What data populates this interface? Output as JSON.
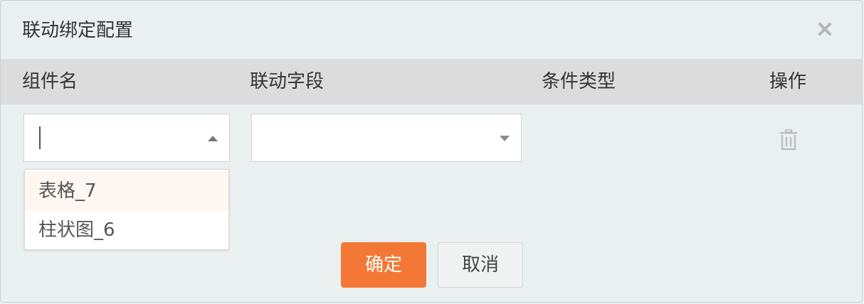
{
  "dialog": {
    "title": "联动绑定配置",
    "close_icon": "close-icon"
  },
  "table": {
    "headers": [
      "组件名",
      "联动字段",
      "条件类型",
      "操作"
    ]
  },
  "row": {
    "component_select": {
      "value": "",
      "expanded": true
    },
    "field_select": {
      "value": "",
      "expanded": false
    },
    "delete_icon": "trash-icon"
  },
  "dropdown": {
    "options": [
      "表格_7",
      "柱状图_6"
    ],
    "hovered_index": 0
  },
  "footer": {
    "confirm_label": "确定",
    "cancel_label": "取消"
  },
  "colors": {
    "primary": "#f47835",
    "header_bg": "#dcdcdc",
    "dialog_bg": "#eaf0f0"
  }
}
